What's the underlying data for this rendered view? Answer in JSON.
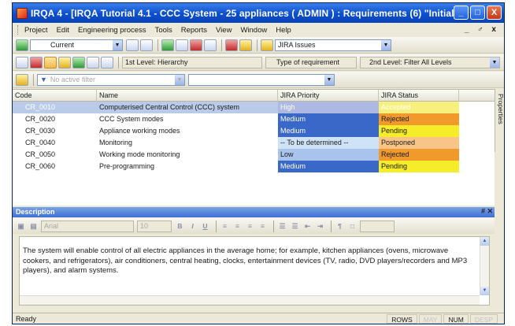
{
  "window": {
    "title": "IRQA 4 - [IRQA Tutorial 4.1 - CCC System - 25 appliances ( ADMIN ) : Requirements (6) \"Initial\"]",
    "minimize_glyph": "_",
    "maximize_glyph": "□",
    "close_glyph": "X"
  },
  "menubar": {
    "items": [
      "Project",
      "Edit",
      "Engineering process",
      "Tools",
      "Reports",
      "View",
      "Window",
      "Help"
    ],
    "mdi_controls": "_ ♂ x"
  },
  "toolbar1": {
    "baseline_combo": "Current",
    "issues_combo": "JIRA Issues"
  },
  "toolbar2": {
    "level1_combo": "1st Level: Hierarchy",
    "type_combo": "Type of requirement",
    "level2_combo": "2nd Level: Filter All Levels"
  },
  "toolbar3": {
    "filter_placeholder": "No active filter"
  },
  "grid": {
    "columns": [
      "Code",
      "Name",
      "JIRA Priority",
      "JIRA Status"
    ],
    "rows": [
      {
        "code": "CR_0010",
        "name": "Computerised Central Control (CCC) system",
        "priority": "High",
        "status": "Accepted"
      },
      {
        "code": "CR_0020",
        "name": "CCC System modes",
        "priority": "Medium",
        "status": "Rejected"
      },
      {
        "code": "CR_0030",
        "name": "Appliance working modes",
        "priority": "Medium",
        "status": "Pending"
      },
      {
        "code": "CR_0040",
        "name": "Monitoring",
        "priority": "-- To be determined --",
        "status": "Postponed"
      },
      {
        "code": "CR_0050",
        "name": "Working mode monitoring",
        "priority": "Low",
        "status": "Rejected"
      },
      {
        "code": "CR_0060",
        "name": "Pre-programming",
        "priority": "Medium",
        "status": "Pending"
      }
    ]
  },
  "side_panel": {
    "label": "Properties"
  },
  "description": {
    "title": "Description",
    "close_glyph": "# ✕",
    "font_combo": "Arial",
    "size_combo": "10",
    "text": "The system will enable control of all electric appliances in the average home; for example, kitchen appliances (ovens, microwave cookers, and refrigerators), air conditioners, central heating, clocks, entertainment devices (TV, radio, DVD players/recorders and MP3 players), and alarm systems."
  },
  "statusbar": {
    "text": "Ready",
    "indicators": [
      {
        "label": "ROWS",
        "active": true
      },
      {
        "label": "MAY",
        "active": false
      },
      {
        "label": "NUM",
        "active": true
      },
      {
        "label": "DESP",
        "active": false
      }
    ]
  },
  "colors": {
    "selected_row": "#b9cbe8",
    "priority_high": "#aeb9e3",
    "priority_medium": "#3a68c8",
    "priority_tbd": "#cfe3f7",
    "priority_low": "#a9c4ec",
    "status_accepted": "#f7f07d",
    "status_rejected": "#f09a2c",
    "status_pending": "#f5ec2a",
    "status_postponed": "#f9c586"
  }
}
